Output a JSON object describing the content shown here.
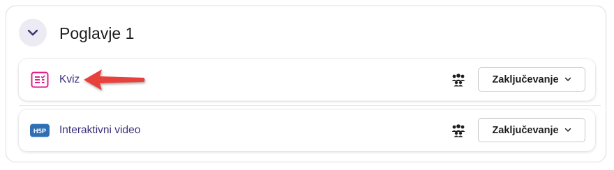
{
  "section": {
    "title": "Poglavje 1",
    "collapse_icon": "chevron-down-icon"
  },
  "activities": [
    {
      "name": "Kviz",
      "icon": "quiz-icon",
      "icon_color": "#e0208a",
      "group_icon": "group-icon",
      "grading_label": "Zaključevanje",
      "dropdown_icon": "chevron-down-icon"
    },
    {
      "name": "Interaktivni video",
      "icon": "h5p-icon",
      "icon_color": "#2f6fb5",
      "icon_text": "H5P",
      "group_icon": "group-icon",
      "grading_label": "Zaključevanje",
      "dropdown_icon": "chevron-down-icon"
    }
  ],
  "annotation": {
    "arrow_icon": "red-arrow-icon",
    "arrow_color": "#e8403a"
  },
  "colors": {
    "link": "#3b2f7a",
    "collapse_bg": "#ecebf3"
  }
}
